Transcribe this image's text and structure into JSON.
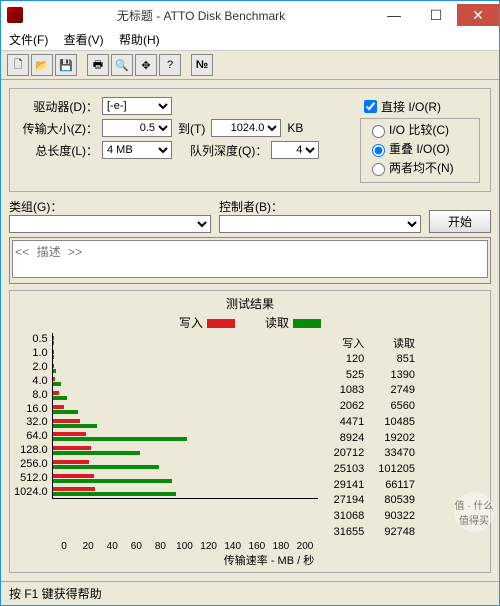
{
  "title": "无标题 - ATTO Disk Benchmark",
  "menu": {
    "file": "文件(F)",
    "view": "查看(V)",
    "help": "帮助(H)"
  },
  "fields": {
    "drive_lbl": "驱动器(D)：",
    "drive_val": "[-e-]",
    "xfer_lbl": "传输大小(Z)：",
    "xfer_from": "0.5",
    "to_lbl": "到(T)",
    "xfer_to": "1024.0",
    "unit": "KB",
    "len_lbl": "总长度(L)：",
    "len_val": "4 MB",
    "queue_lbl": "队列深度(Q)：",
    "queue_val": "4",
    "direct": "直接 I/O(R)",
    "cmp": "I/O 比较(C)",
    "overlap": "重叠 I/O(O)",
    "neither": "两者均不(N)"
  },
  "group_lbl": "类组(G)：",
  "ctrl_lbl": "控制者(B)：",
  "start": "开始",
  "desc": "<< 描述 >>",
  "chart_title": "测试结果",
  "write_lbl": "写入",
  "read_lbl": "读取",
  "xlabel": "传输速率 - MB / 秒",
  "colors": {
    "write": "#d81e1e",
    "read": "#0a8a0a"
  },
  "chart_data": {
    "type": "bar",
    "categories": [
      "0.5",
      "1.0",
      "2.0",
      "4.0",
      "8.0",
      "16.0",
      "32.0",
      "64.0",
      "128.0",
      "256.0",
      "512.0",
      "1024.0"
    ],
    "series": [
      {
        "name": "写入",
        "values": [
          120,
          525,
          1083,
          2062,
          4471,
          8924,
          20712,
          25103,
          29141,
          27194,
          31068,
          31655
        ]
      },
      {
        "name": "读取",
        "values": [
          851,
          1390,
          2749,
          6560,
          10485,
          19202,
          33470,
          101205,
          66117,
          80539,
          90322,
          92748
        ]
      }
    ],
    "xlabel": "传输速率 - MB / 秒",
    "xlim": [
      0,
      200
    ],
    "xticks": [
      0,
      20,
      40,
      60,
      80,
      100,
      120,
      140,
      160,
      180,
      200
    ]
  },
  "status": "按 F1 键获得帮助",
  "watermark": "值 · 什么值得买"
}
